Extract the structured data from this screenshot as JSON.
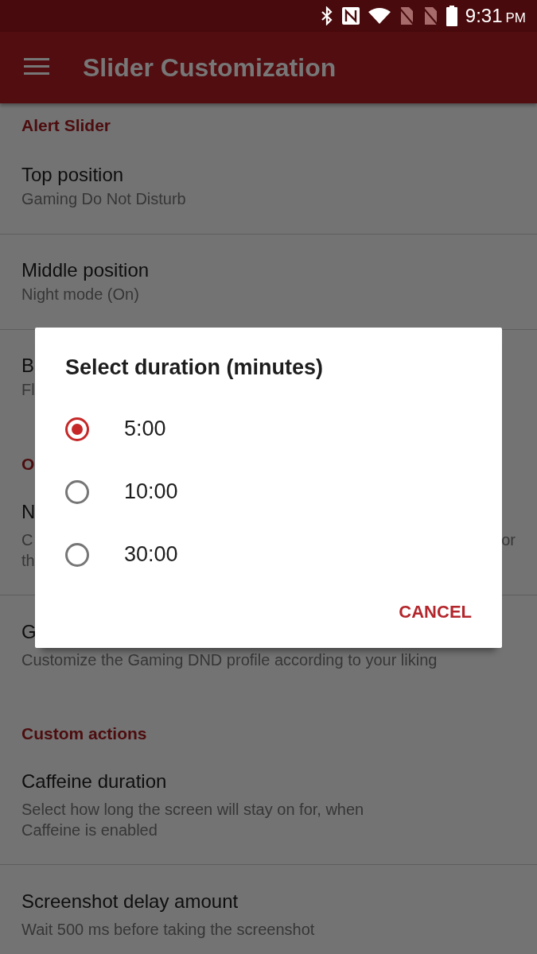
{
  "status_bar": {
    "time": "9:31",
    "time_suffix": "PM"
  },
  "app_bar": {
    "title": "Slider Customization"
  },
  "sections": [
    {
      "header": "Alert Slider",
      "items": [
        {
          "title": "Top position",
          "subtitle_lines": [
            [
              "Gaming Do Not Disturb"
            ]
          ]
        },
        {
          "title": "Middle position",
          "subtitle_lines": [
            [
              "Night mode (On)"
            ]
          ]
        },
        {
          "title": "B",
          "subtitle_lines": [
            [
              "Fl"
            ]
          ]
        }
      ]
    },
    {
      "header": "O",
      "items": [
        {
          "title": "N",
          "subtitle_lines": [
            [
              "C",
              "or"
            ],
            [
              "th"
            ]
          ]
        },
        {
          "title": "G",
          "subtitle_lines": [
            [
              "Customize the Gaming DND profile according to your liking"
            ]
          ]
        }
      ]
    },
    {
      "header": "Custom actions",
      "items": [
        {
          "title": "Caffeine duration",
          "subtitle_lines": [
            [
              "Select how long the screen will stay on for, when"
            ],
            [
              "Caffeine is enabled"
            ]
          ]
        },
        {
          "title": "Screenshot delay amount",
          "subtitle_lines": [
            [
              "Wait 500 ms before taking the screenshot"
            ]
          ]
        }
      ]
    }
  ],
  "dialog": {
    "title": "Select duration (minutes)",
    "options": [
      {
        "label": "5:00",
        "selected": true
      },
      {
        "label": "10:00",
        "selected": false
      },
      {
        "label": "30:00",
        "selected": false
      }
    ],
    "buttons": [
      "CANCEL"
    ]
  }
}
